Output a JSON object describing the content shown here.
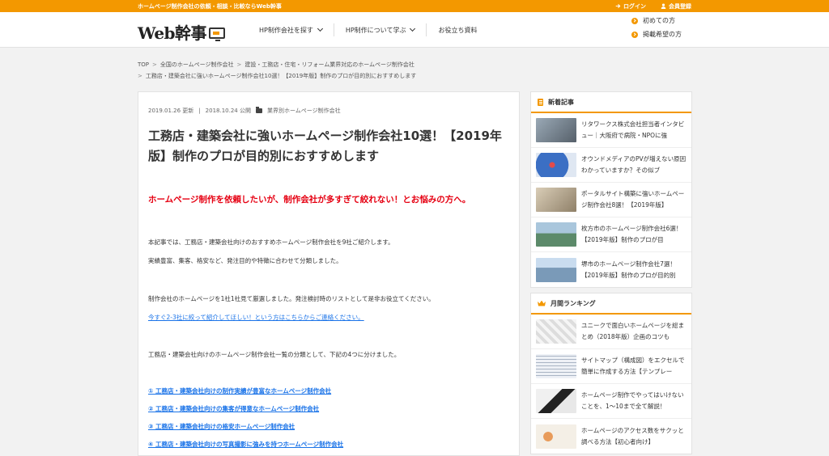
{
  "topbar": {
    "tagline": "ホームページ制作会社の依頼・相談・比較ならWeb幹事",
    "login": "ログイン",
    "register": "会員登録"
  },
  "header": {
    "logo_text": "Web幹事",
    "nav": [
      {
        "label": "HP制作会社を探す"
      },
      {
        "label": "HP制作について学ぶ"
      },
      {
        "label": "お役立ち資料"
      }
    ],
    "links": [
      {
        "label": "初めての方"
      },
      {
        "label": "掲載希望の方"
      }
    ]
  },
  "breadcrumb": {
    "items": [
      "TOP",
      "全国のホームページ制作会社",
      "建設・工務店・住宅・リフォーム業界対応のホームページ制作会社",
      "工務店・建築会社に強いホームページ制作会社10選！【2019年版】制作のプロが目的別におすすめします"
    ]
  },
  "article": {
    "updated": "2019.01.26 更新",
    "published": "2018.10.24 公開",
    "category": "業界別ホームページ制作会社",
    "title": "工務店・建築会社に強いホームページ制作会社10選！【2019年版】制作のプロが目的別におすすめします",
    "lead": "ホームページ制作を依頼したいが、制作会社が多すぎて絞れない！とお悩みの方へ。",
    "p1": "本記事では、工務店・建築会社向けのおすすめホームページ制作会社を9社ご紹介します。",
    "p2": "実績豊富、集客、格安など、発注目的や特徴に合わせて分類しました。",
    "p3": "制作会社のホームページを1社1社見て厳選しました。発注検討時のリストとして是非お役立てください。",
    "cta_link": "今すぐ2-3社に絞って紹介してほしい！という方はこちらからご連絡ください。",
    "p4": "工務店・建築会社向けのホームページ制作会社一覧の分類として、下記の4つに分けました。",
    "toc": [
      "① 工務店・建築会社向けの制作実績が豊富なホームページ制作会社",
      "② 工務店・建築会社向けの集客が得意なホームページ制作会社",
      "③ 工務店・建築会社向けの格安ホームページ制作会社",
      "④ 工務店・建築会社向けの写真撮影に強みを持つホームページ制作会社"
    ]
  },
  "sidebar": {
    "new_title": "新着記事",
    "new_items": [
      {
        "text": "リタワークス株式会社担当者インタビュー｜大阪府で病院・NPOに強",
        "color": "#8a9aa8"
      },
      {
        "text": "オウンドメディアのPVが増えない原因わかっていますか？その似ブ",
        "color": "#3b6fc4"
      },
      {
        "text": "ポータルサイト構築に強いホームページ制作会社8選！【2019年版】",
        "color": "#b8a88f"
      },
      {
        "text": "枚方市のホームページ制作会社6選！【2019年版】制作のプロが目",
        "color": "#5c8a6a"
      },
      {
        "text": "堺市のホームページ制作会社7選！【2019年版】制作のプロが目的別",
        "color": "#7a9ab8"
      }
    ],
    "rank_title": "月間ランキング",
    "rank_items": [
      {
        "text": "ユニークで面白いホームページを総まとめ（2018年版）企画のコツも",
        "color": "#c9c9c9"
      },
      {
        "text": "サイトマップ（構成図）をエクセルで簡単に作成する方法【テンプレー",
        "color": "#a9b4c4"
      },
      {
        "text": "ホームページ制作でやってはいけないことを、1〜10まで全て解説！",
        "color": "#555555"
      },
      {
        "text": "ホームページのアクセス数をサクッと調べる方法【初心者向け】",
        "color": "#d9c9a9"
      }
    ]
  },
  "colors": {
    "accent": "#f39800",
    "lead": "#e60012",
    "link": "#1a73e8"
  }
}
